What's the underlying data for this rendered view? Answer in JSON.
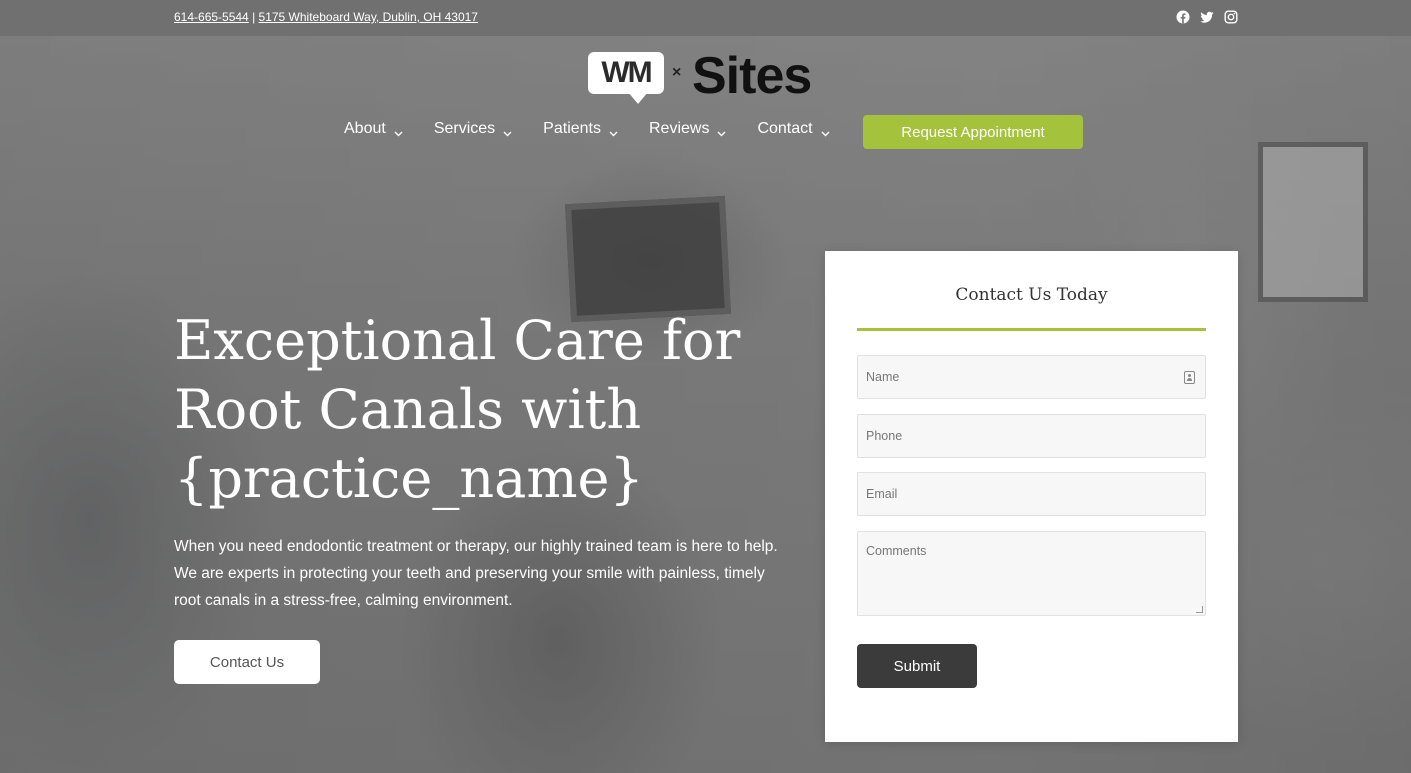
{
  "topbar": {
    "phone": "614-665-5544",
    "separator": " | ",
    "address": "5175 Whiteboard Way, Dublin, OH 43017",
    "social": [
      "facebook-icon",
      "twitter-icon",
      "instagram-icon"
    ]
  },
  "logo": {
    "badge_text": "WM",
    "x_text": "×",
    "sites_text": "Sites"
  },
  "nav": {
    "items": [
      {
        "label": "About"
      },
      {
        "label": "Services"
      },
      {
        "label": "Patients"
      },
      {
        "label": "Reviews"
      },
      {
        "label": "Contact"
      }
    ],
    "cta_label": "Request Appointment"
  },
  "hero": {
    "title": "Exceptional Care for Root Canals with {practice_name}",
    "description": "When you need endodontic treatment or therapy, our highly trained team is here to help. We are experts in protecting your teeth and preserving your smile with painless, timely root canals in a stress-free, calming environment.",
    "button_label": "Contact Us"
  },
  "form": {
    "title": "Contact Us Today",
    "fields": {
      "name_placeholder": "Name",
      "phone_placeholder": "Phone",
      "email_placeholder": "Email",
      "comments_placeholder": "Comments"
    },
    "submit_label": "Submit"
  },
  "colors": {
    "accent": "#a4c23b",
    "submit_bg": "#3b3b3b",
    "overlay": "#6f6f6f"
  }
}
